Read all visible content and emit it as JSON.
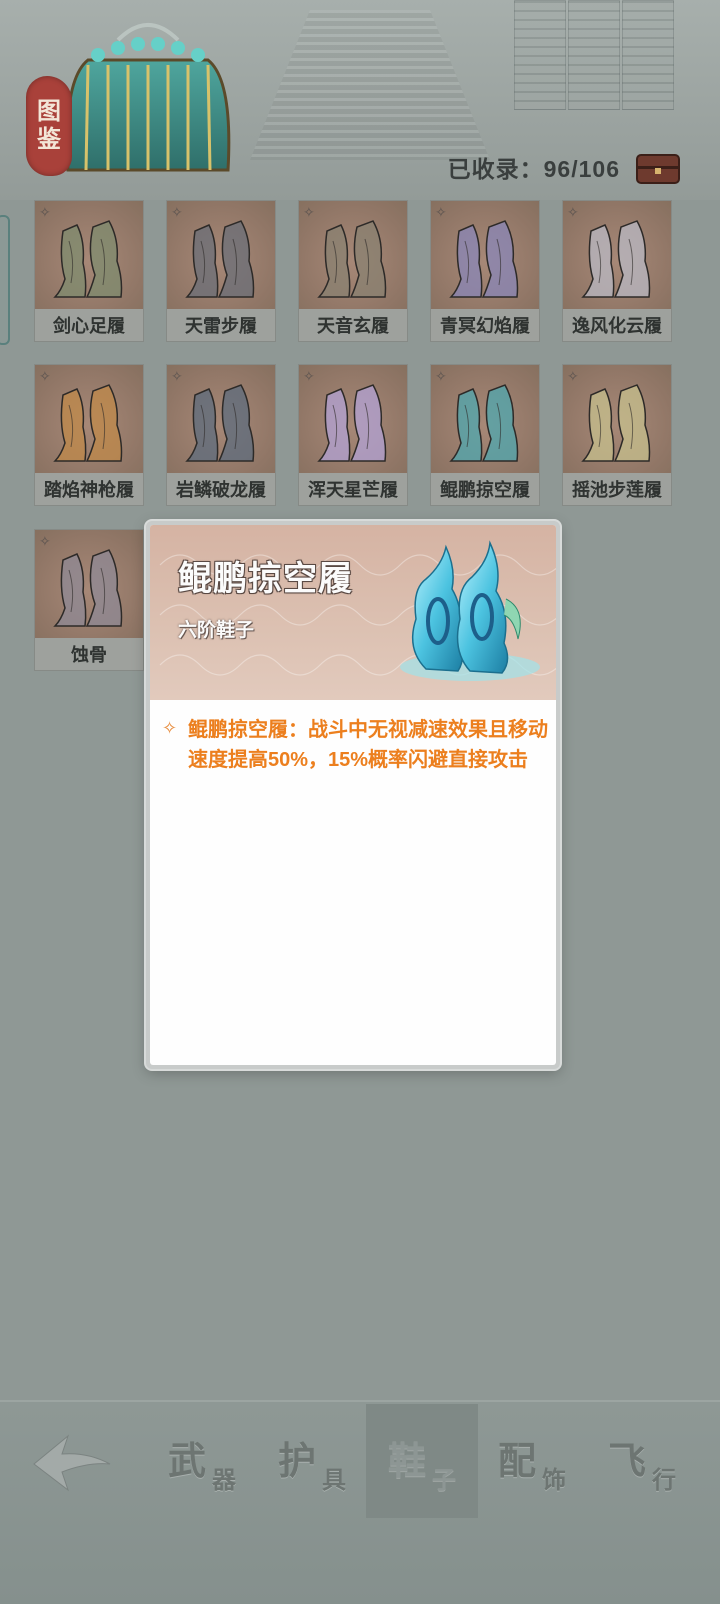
{
  "header": {
    "title_chars": [
      "图",
      "鉴"
    ],
    "collected_label": "已收录：96/106"
  },
  "items": [
    {
      "name": "剑心足履",
      "tint": "#7f8c6f"
    },
    {
      "name": "天雷步履",
      "tint": "#6b6f78"
    },
    {
      "name": "天音玄履",
      "tint": "#8a8172"
    },
    {
      "name": "青冥幻焰履",
      "tint": "#8a87b8"
    },
    {
      "name": "逸风化云履",
      "tint": "#b9b9c4"
    },
    {
      "name": "踏焰神枪履",
      "tint": "#c08a4a"
    },
    {
      "name": "岩鳞破龙履",
      "tint": "#5e6c7d"
    },
    {
      "name": "浑天星芒履",
      "tint": "#b3a3d6"
    },
    {
      "name": "鲲鹏掠空履",
      "tint": "#4fa8b0"
    },
    {
      "name": "摇池步莲履",
      "tint": "#c7c08e"
    },
    {
      "name": "蚀骨",
      "tint": "#8f8a96"
    }
  ],
  "modal": {
    "title": "鲲鹏掠空履",
    "grade": "六阶鞋子",
    "description": "鲲鹏掠空履：战斗中无视减速效果且移动速度提高50%，15%概率闪避直接攻击"
  },
  "nav": {
    "tabs": [
      {
        "big": "武",
        "small": "器",
        "active": false
      },
      {
        "big": "护",
        "small": "具",
        "active": false
      },
      {
        "big": "鞋",
        "small": "子",
        "active": true
      },
      {
        "big": "配",
        "small": "饰",
        "active": false
      },
      {
        "big": "飞",
        "small": "行",
        "active": false
      }
    ]
  },
  "colors": {
    "accent_orange": "#ec7f1e",
    "seal_red": "#a9413a"
  }
}
